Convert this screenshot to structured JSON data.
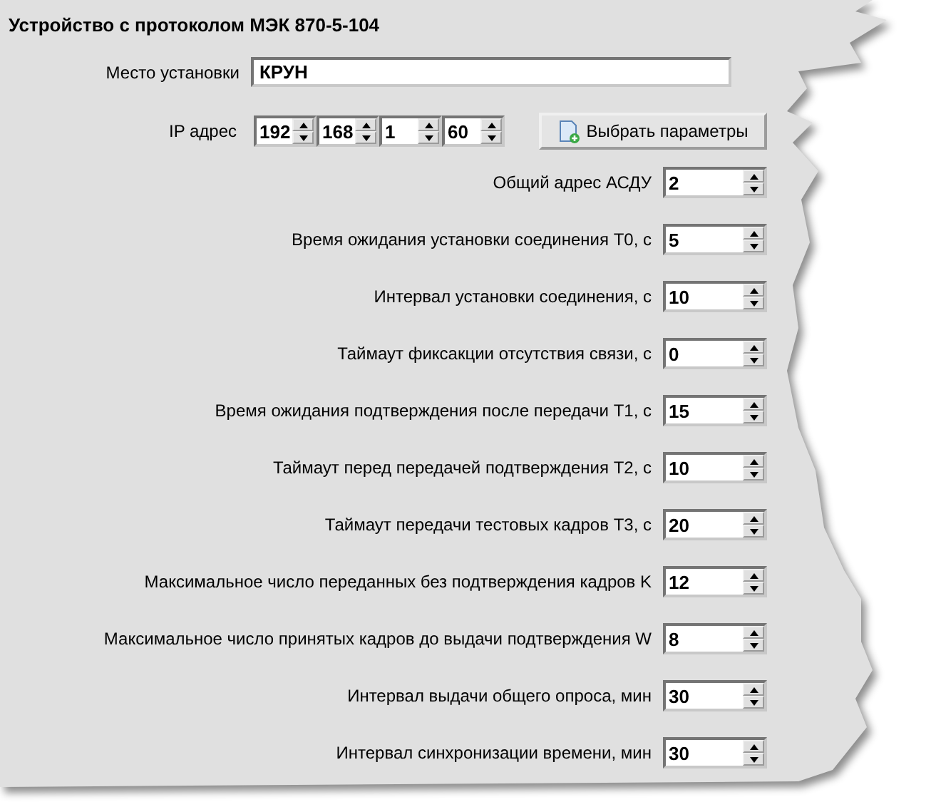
{
  "title": "Устройство с протоколом МЭК 870-5-104",
  "location": {
    "label": "Место установки",
    "value": "КРУН"
  },
  "ip": {
    "label": "IP адрес",
    "octets": [
      "192",
      "168",
      "1",
      "60"
    ]
  },
  "select_button": {
    "label": "Выбрать параметры"
  },
  "parameters": [
    {
      "label": "Общий адрес АСДУ",
      "value": "2"
    },
    {
      "label": "Время ожидания установки соединения Т0, с",
      "value": "5"
    },
    {
      "label": "Интервал установки соединения, с",
      "value": "10"
    },
    {
      "label": "Таймаут фиксакции отсутствия связи, с",
      "value": "0"
    },
    {
      "label": "Время ожидания подтверждения после передачи Т1, с",
      "value": "15"
    },
    {
      "label": "Таймаут перед передачей подтверждения Т2, с",
      "value": "10"
    },
    {
      "label": "Таймаут передачи тестовых кадров Т3, с",
      "value": "20"
    },
    {
      "label": "Максимальное число переданных без подтверждения кадров K",
      "value": "12"
    },
    {
      "label": "Максимальное число принятых кадров до выдачи подтверждения W",
      "value": "8"
    },
    {
      "label": "Интервал выдачи общего опроса, мин",
      "value": "30"
    },
    {
      "label": "Интервал синхронизации времени, мин",
      "value": "30"
    }
  ]
}
